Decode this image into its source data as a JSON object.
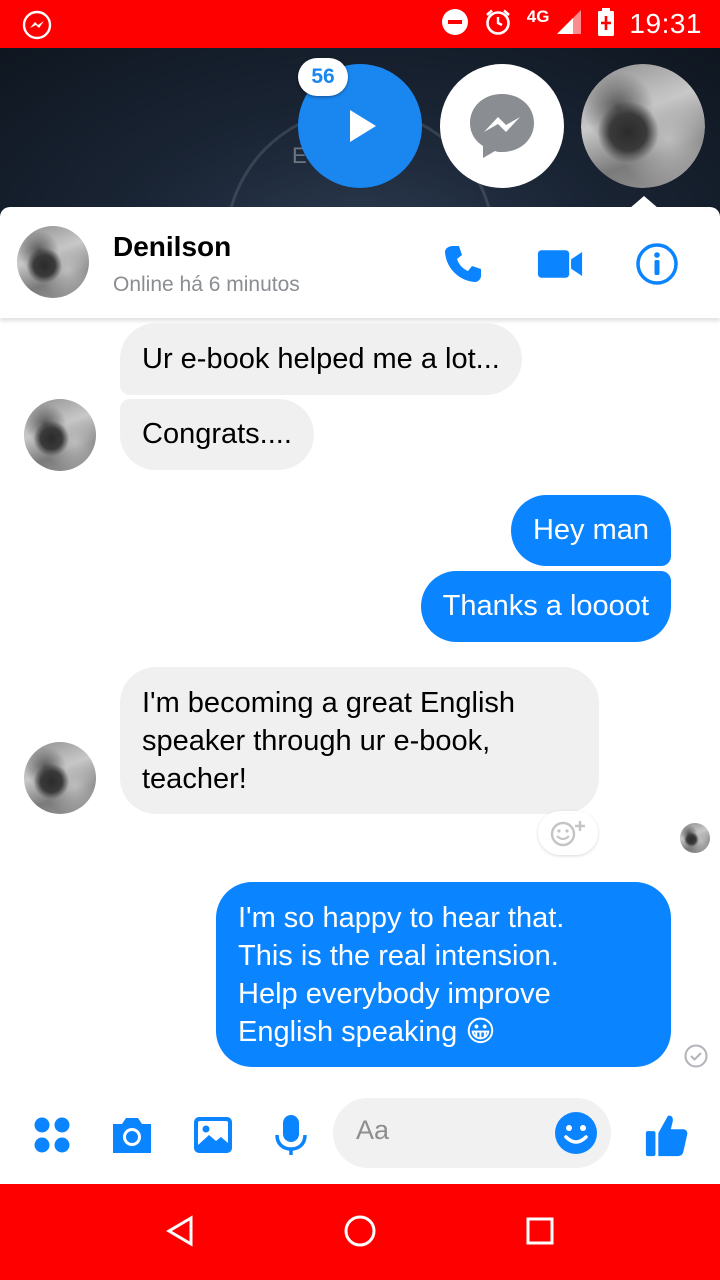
{
  "status_bar": {
    "network": "4G",
    "time": "19:31",
    "background_color": "#ff0000"
  },
  "chat_heads": {
    "badge_count": "56",
    "accent_color": "#1a87f0",
    "bg_text": "E            s"
  },
  "conversation": {
    "contact_name": "Denilson",
    "status": "Online há 6 minutos",
    "icons": [
      "phone-icon",
      "video-camera-icon",
      "info-icon"
    ],
    "accent_color": "#0a84ff"
  },
  "messages": [
    {
      "direction": "in",
      "text": "Ur e-book helped me a lot..."
    },
    {
      "direction": "in",
      "text": "Congrats...."
    },
    {
      "direction": "out",
      "text": "Hey man"
    },
    {
      "direction": "out",
      "text": "Thanks a loooot"
    },
    {
      "direction": "in",
      "lines": [
        "I'm becoming a great English",
        "speaker through ur e-book,",
        "teacher!"
      ]
    },
    {
      "direction": "out",
      "lines": [
        "I'm so happy to hear that.",
        "This is the real intension.",
        "Help everybody improve",
        "English speaking"
      ],
      "emoji": "😀"
    }
  ],
  "composer": {
    "placeholder": "Aa",
    "icons": [
      "more-apps-icon",
      "camera-icon",
      "gallery-icon",
      "microphone-icon",
      "emoji-icon",
      "like-icon"
    ]
  },
  "nav_bar": {
    "icons": [
      "back-icon",
      "home-icon",
      "recents-icon"
    ]
  }
}
